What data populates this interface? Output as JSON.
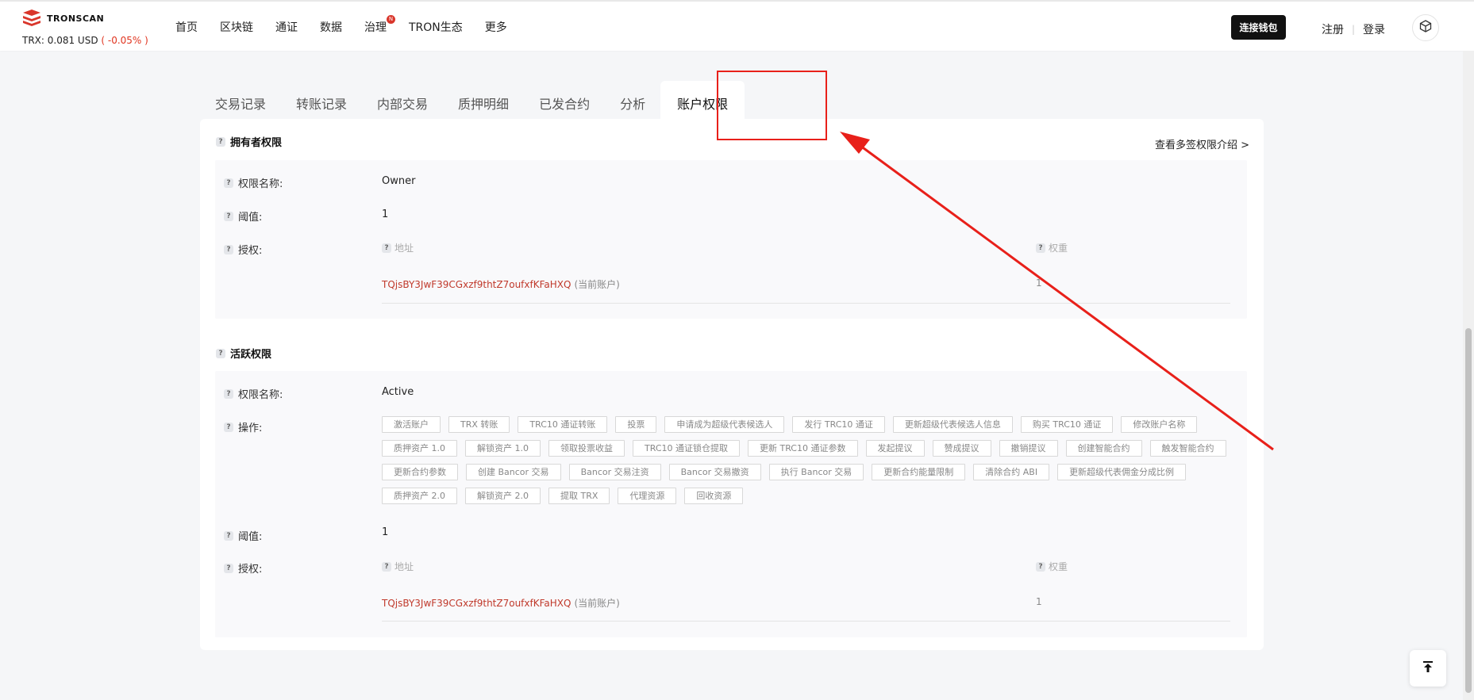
{
  "header": {
    "brand": "TRONSCAN",
    "price_prefix": "TRX: 0.081 USD",
    "price_change": "( -0.05% )",
    "nav": [
      "首页",
      "区块链",
      "通证",
      "数据",
      "治理",
      "TRON生态",
      "更多"
    ],
    "nav_badge": "N",
    "connect_wallet": "连接钱包",
    "register": "注册",
    "login": "登录",
    "separator": "|"
  },
  "tabs": [
    "交易记录",
    "转账记录",
    "内部交易",
    "质押明细",
    "已发合约",
    "分析",
    "账户权限"
  ],
  "owner": {
    "title": "拥有者权限",
    "multisig_link": "查看多签权限介绍 >",
    "name_label": "权限名称:",
    "name_value": "Owner",
    "threshold_label": "阈值:",
    "threshold_value": "1",
    "auth_label": "授权:",
    "address_head": "地址",
    "weight_head": "权重",
    "address": "TQjsBY3JwF39CGxzf9thtZ7oufxfKFaHXQ",
    "current_account": "(当前账户)",
    "weight": "1"
  },
  "active": {
    "title": "活跃权限",
    "name_label": "权限名称:",
    "name_value": "Active",
    "ops_label": "操作:",
    "operations": [
      "激活账户",
      "TRX 转账",
      "TRC10 通证转账",
      "投票",
      "申请成为超级代表候选人",
      "发行 TRC10 通证",
      "更新超级代表候选人信息",
      "购买 TRC10 通证",
      "修改账户名称",
      "质押资产 1.0",
      "解锁资产 1.0",
      "领取投票收益",
      "TRC10 通证锁仓提取",
      "更新 TRC10 通证参数",
      "发起提议",
      "赞成提议",
      "撤销提议",
      "创建智能合约",
      "触发智能合约",
      "更新合约参数",
      "创建 Bancor 交易",
      "Bancor 交易注资",
      "Bancor 交易撤资",
      "执行 Bancor 交易",
      "更新合约能量限制",
      "清除合约 ABI",
      "更新超级代表佣金分成比例",
      "质押资产 2.0",
      "解锁资产 2.0",
      "提取 TRX",
      "代理资源",
      "回收资源"
    ],
    "threshold_label": "阈值:",
    "threshold_value": "1",
    "auth_label": "授权:",
    "address_head": "地址",
    "weight_head": "权重",
    "address": "TQjsBY3JwF39CGxzf9thtZ7oufxfKFaHXQ",
    "current_account": "(当前账户)",
    "weight": "1"
  },
  "colors": {
    "accent_red": "#e8201a",
    "address_red": "#c0392b"
  },
  "icons": {
    "help": "?",
    "back_to_top": "arrow-up-bar-icon"
  }
}
